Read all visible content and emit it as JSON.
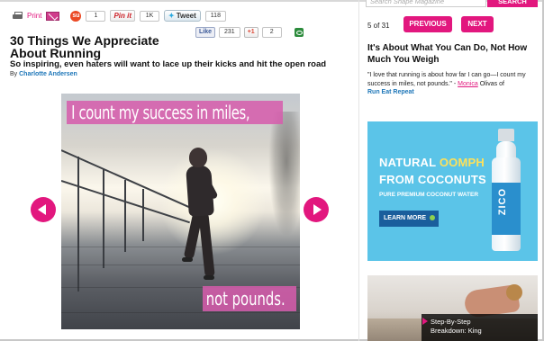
{
  "sharebar": {
    "print_label": "Print",
    "stumble_count": "1",
    "pinit_label": "Pin it",
    "pin_count": "1K",
    "tweet_label": "Tweet",
    "tweet_count": "118"
  },
  "social": {
    "like_label": "Like",
    "like_count": "231",
    "gplus_label": "+1",
    "gplus_count": "2"
  },
  "article": {
    "title": "30 Things We Appreciate About Running",
    "subtitle": "So inspiring, even haters will want to lace up their kicks and hit the open road",
    "byline_prefix": "By",
    "author": "Charlotte Andersen"
  },
  "slide": {
    "quote_top": "I count my success in miles,",
    "quote_bottom": "not pounds."
  },
  "sidebar": {
    "search_placeholder": "Search Shape Magazine",
    "search_button": "SEARCH",
    "counter": "5 of 31",
    "prev_label": "PREVIOUS",
    "next_label": "NEXT",
    "headline": "It's About What You Can Do, Not How Much You Weigh",
    "caption_quote": "\"I love that running is about how far I can go—I count my success in miles, not pounds.\" -",
    "caption_name": "Monica",
    "caption_rest": "Olivas of",
    "caption_site": "Run Eat Repeat"
  },
  "ad": {
    "line1_a": "NATURAL",
    "line1_b": "OOMPH",
    "line2": "FROM COCONUTS",
    "line3": "PURE PREMIUM COCONUT WATER",
    "cta": "LEARN MORE",
    "brand": "ZICO",
    "colors": {
      "background": "#5bc4e8",
      "accent": "#fde15b",
      "cta": "#1a5e9c"
    }
  },
  "video": {
    "caption_line1": "Step-By-Step",
    "caption_line2": "Breakdown: King"
  },
  "theme": {
    "accent": "#e2177e",
    "link": "#1d76b8"
  }
}
